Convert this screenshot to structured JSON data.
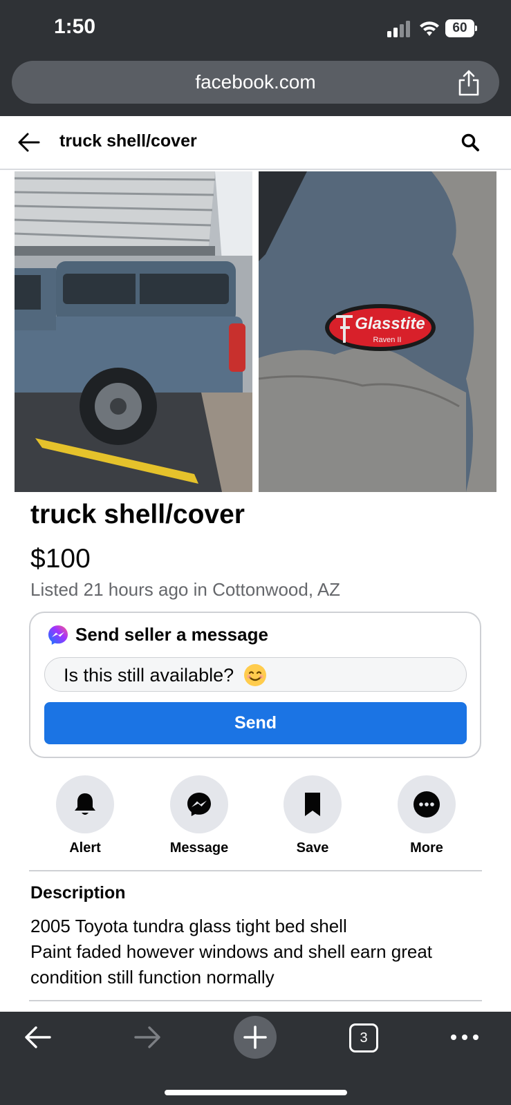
{
  "status_bar": {
    "time": "1:50",
    "battery": "60"
  },
  "browser": {
    "url": "facebook.com",
    "tabs_count": "3"
  },
  "header": {
    "title": "truck shell/cover"
  },
  "photos": {
    "badge_brand": "Glasstite",
    "badge_model": "Raven II"
  },
  "listing": {
    "title": "truck shell/cover",
    "price": "$100",
    "meta": "Listed 21 hours ago in Cottonwood, AZ"
  },
  "message": {
    "heading": "Send seller a message",
    "input_value": "Is this still available?",
    "send_label": "Send"
  },
  "actions": [
    {
      "label": "Alert",
      "icon": "bell-icon"
    },
    {
      "label": "Message",
      "icon": "messenger-icon"
    },
    {
      "label": "Save",
      "icon": "bookmark-icon"
    },
    {
      "label": "More",
      "icon": "more-icon"
    }
  ],
  "description": {
    "heading": "Description",
    "lines": [
      "2005 Toyota tundra glass tight bed shell",
      "Paint faded however windows and shell earn great",
      "condition still function normally"
    ]
  },
  "colors": {
    "accent": "#1b74e4",
    "chrome": "#2f3236"
  }
}
